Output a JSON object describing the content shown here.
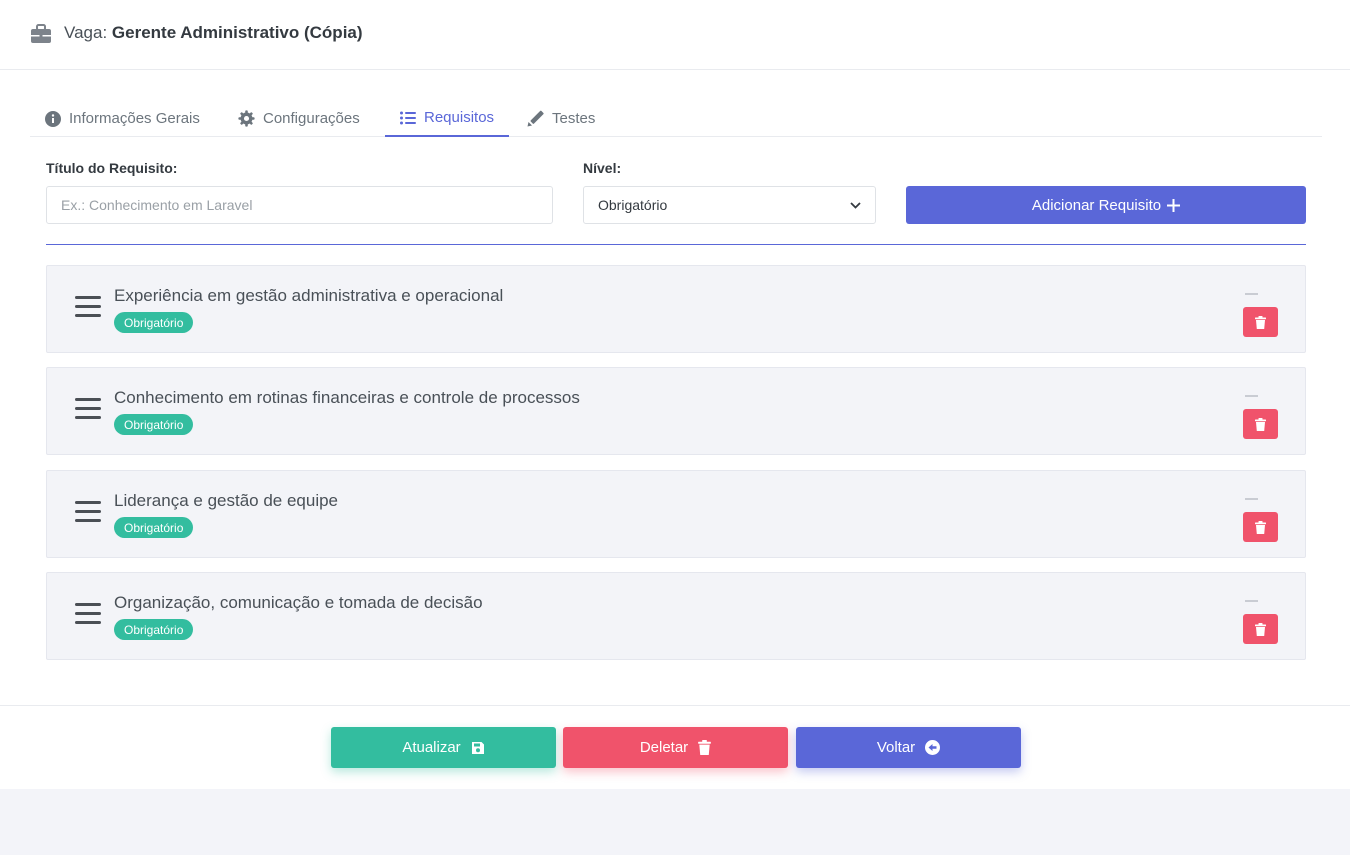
{
  "header": {
    "label": "Vaga:",
    "job_title": "Gerente Administrativo (Cópia)"
  },
  "tabs": [
    {
      "label": "Informações Gerais",
      "icon": "info-icon",
      "active": false
    },
    {
      "label": "Configurações",
      "icon": "gear-icon",
      "active": false
    },
    {
      "label": "Requisitos",
      "icon": "list-icon",
      "active": true
    },
    {
      "label": "Testes",
      "icon": "pencil-icon",
      "active": false
    }
  ],
  "form": {
    "title_label": "Título do Requisito:",
    "title_placeholder": "Ex.: Conhecimento em Laravel",
    "level_label": "Nível:",
    "level_value": "Obrigatório",
    "add_button": "Adicionar Requisito"
  },
  "requirements": [
    {
      "title": "Experiência em gestão administrativa e operacional",
      "level": "Obrigatório"
    },
    {
      "title": "Conhecimento em rotinas financeiras e controle de processos",
      "level": "Obrigatório"
    },
    {
      "title": "Liderança e gestão de equipe",
      "level": "Obrigatório"
    },
    {
      "title": "Organização, comunicação e tomada de decisão",
      "level": "Obrigatório"
    }
  ],
  "footer": {
    "update": "Atualizar",
    "delete": "Deletar",
    "back": "Voltar"
  },
  "colors": {
    "primary": "#5a67d8",
    "success": "#33bd9f",
    "danger": "#f0536b"
  }
}
